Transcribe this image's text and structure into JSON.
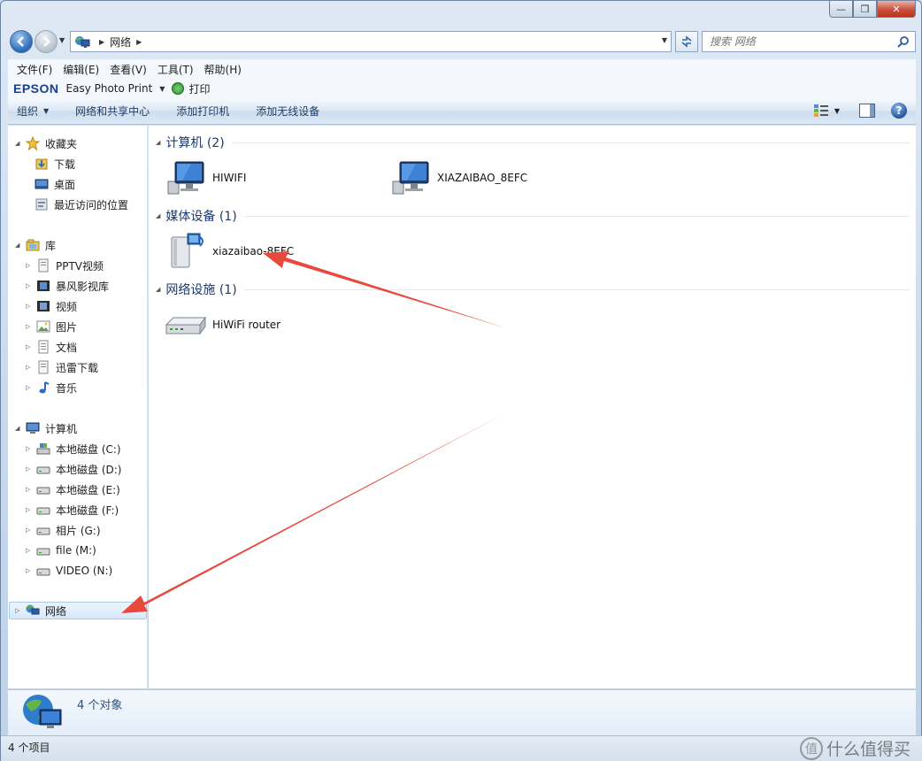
{
  "window": {
    "controls": {
      "minimize": "—",
      "maximize": "❐",
      "close": "✕"
    }
  },
  "address": {
    "crumbs": [
      "网络"
    ],
    "search_placeholder": "搜索 网络"
  },
  "menu": [
    "文件(F)",
    "编辑(E)",
    "查看(V)",
    "工具(T)",
    "帮助(H)"
  ],
  "epson": {
    "logo": "EPSON",
    "app": "Easy Photo Print",
    "print_label": "打印"
  },
  "commands": {
    "organize": "组织",
    "network_center": "网络和共享中心",
    "add_printer": "添加打印机",
    "add_wireless": "添加无线设备"
  },
  "navpane": {
    "favorites": {
      "label": "收藏夹",
      "items": [
        "下载",
        "桌面",
        "最近访问的位置"
      ]
    },
    "libraries": {
      "label": "库",
      "items": [
        "PPTV视频",
        "暴风影视库",
        "视频",
        "图片",
        "文档",
        "迅雷下载",
        "音乐"
      ]
    },
    "computer": {
      "label": "计算机",
      "items": [
        "本地磁盘 (C:)",
        "本地磁盘 (D:)",
        "本地磁盘 (E:)",
        "本地磁盘 (F:)",
        "相片 (G:)",
        "file (M:)",
        "VIDEO (N:)"
      ]
    },
    "network": {
      "label": "网络"
    }
  },
  "groups": [
    {
      "header": "计算机 (2)",
      "items": [
        "HIWIFI",
        "XIAZAIBAO_8EFC"
      ]
    },
    {
      "header": "媒体设备 (1)",
      "items": [
        "xiazaibao-8EFC"
      ]
    },
    {
      "header": "网络设施 (1)",
      "items": [
        "HiWiFi router"
      ]
    }
  ],
  "details": {
    "count": "4 个对象"
  },
  "status": {
    "items": "4 个项目"
  },
  "watermark": {
    "logo": "值",
    "text": "什么值得买"
  },
  "colors": {
    "annotation_arrow": "#e8493c",
    "accent": "#1e3a6e"
  }
}
